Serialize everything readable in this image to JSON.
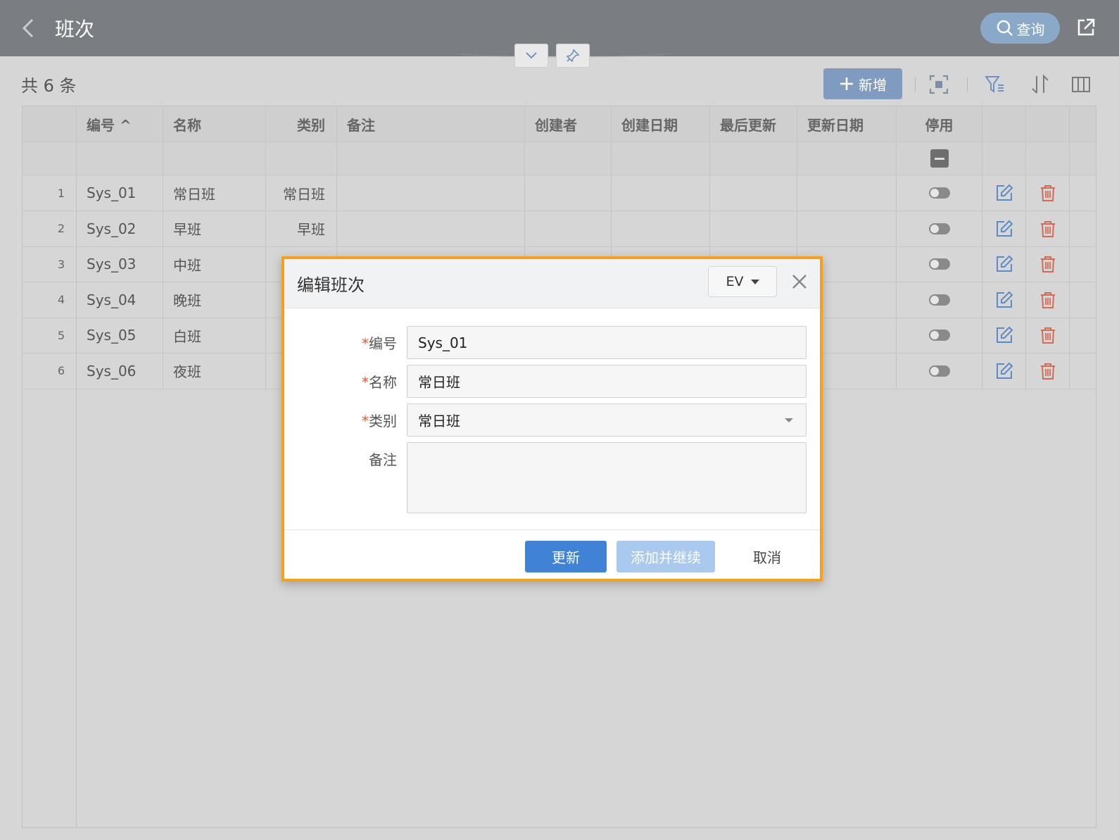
{
  "header": {
    "title": "班次",
    "search_label": "查询"
  },
  "toolbar": {
    "count_text": "共 6 条",
    "add_label": "新增"
  },
  "grid": {
    "columns": [
      "编号 ^",
      "名称",
      "类别",
      "备注",
      "创建者",
      "创建日期",
      "最后更新",
      "更新日期",
      "停用"
    ],
    "rows": [
      {
        "index": "1",
        "code": "Sys_01",
        "name": "常日班",
        "type": "常日班"
      },
      {
        "index": "2",
        "code": "Sys_02",
        "name": "早班",
        "type": "早班"
      },
      {
        "index": "3",
        "code": "Sys_03",
        "name": "中班",
        "type": ""
      },
      {
        "index": "4",
        "code": "Sys_04",
        "name": "晚班",
        "type": ""
      },
      {
        "index": "5",
        "code": "Sys_05",
        "name": "白班",
        "type": ""
      },
      {
        "index": "6",
        "code": "Sys_06",
        "name": "夜班",
        "type": ""
      }
    ]
  },
  "dialog": {
    "title": "编辑班次",
    "lang": "EV",
    "fields": {
      "code_label": "编号",
      "code_value": "Sys_01",
      "name_label": "名称",
      "name_value": "常日班",
      "type_label": "类别",
      "type_value": "常日班",
      "note_label": "备注",
      "note_value": ""
    },
    "buttons": {
      "update": "更新",
      "add_continue": "添加并继续",
      "cancel": "取消"
    }
  },
  "colors": {
    "header_bg": "#7a7e82",
    "dialog_border": "#f4a21c",
    "primary": "#3f82d6",
    "edit_icon": "#5b8cc8",
    "delete_icon": "#d36b55"
  }
}
